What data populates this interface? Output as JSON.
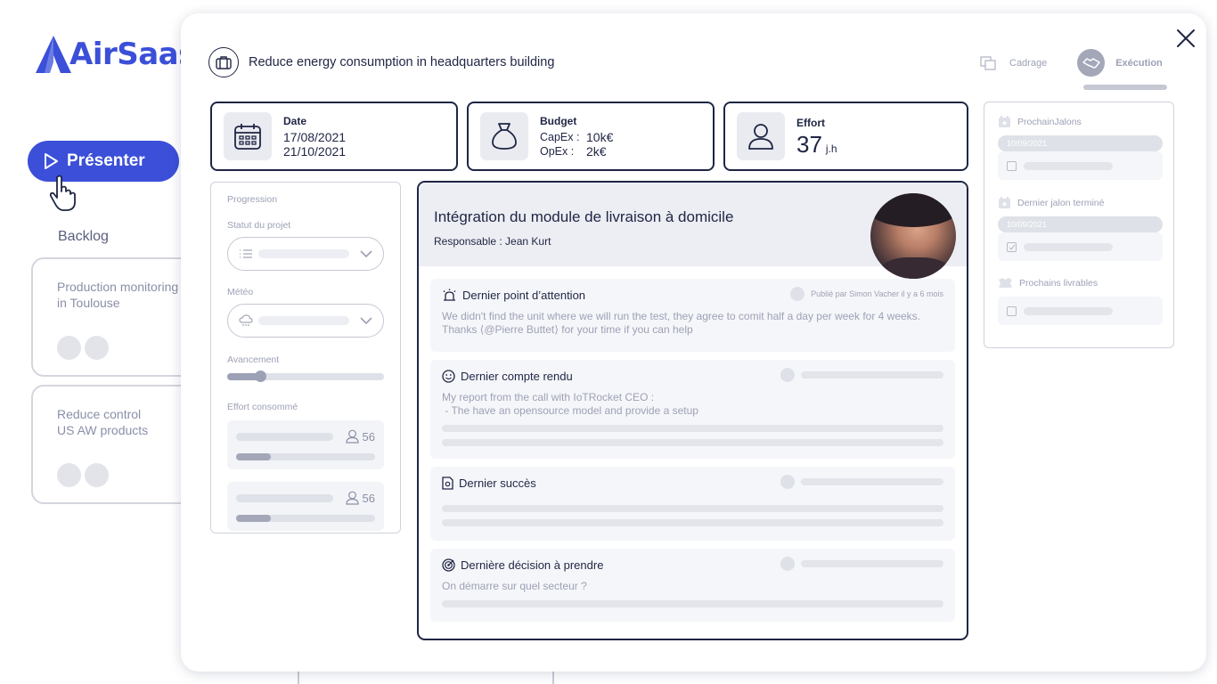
{
  "app": {
    "brand": "AirSaas",
    "brand_color": "#3b4fd8"
  },
  "sidebar": {
    "present_label": "Présenter",
    "backlog_label": "Backlog",
    "cards": [
      {
        "line1": "Production monitoring",
        "line2": "in Toulouse"
      },
      {
        "line1": "Reduce control",
        "line2": "US AW products"
      }
    ]
  },
  "modal": {
    "project_title": "Reduce energy consumption in headquarters building",
    "phases": {
      "cadrage": "Cadrage",
      "execution": "Exécution"
    },
    "date": {
      "label": "Date",
      "start": "17/08/2021",
      "end": "21/10/2021"
    },
    "budget": {
      "label": "Budget",
      "capex_key": "CapEx :",
      "capex_val": "10k€",
      "opex_key": "OpEx :",
      "opex_val": "2k€"
    },
    "effort": {
      "label": "Effort",
      "value": "37",
      "unit": "j.h"
    },
    "left": {
      "progression": "Progression",
      "status": "Statut du projet",
      "meteo": "Météo",
      "advancement": "Avancement",
      "advancement_fraction": 0.21,
      "effort_consumed": "Effort consommé",
      "effort_rows": [
        {
          "value": "56",
          "fraction": 0.25
        },
        {
          "value": "56",
          "fraction": 0.25
        }
      ]
    },
    "main": {
      "title": "Intégration du module de livraison à domicile",
      "responsible": "Responsable : Jean Kurt",
      "attention": {
        "title": "Dernier point d’attention",
        "meta": "Publié par Simon Vacher il y a 6 mois",
        "text1": "We didn't find the unit where we will run the test, they agree to comit half a day per week for 4 weeks.",
        "text2": "Thanks ⟨@Pierre Buttet⟩ for your time if you can help"
      },
      "report": {
        "title": "Dernier compte rendu",
        "text1": "My report from the call with IoTRocket CEO :",
        "text2": " - The have an opensource model and provide a setup"
      },
      "success": {
        "title": "Dernier succès"
      },
      "decision": {
        "title": "Dernière décision à prendre",
        "text": "On démarre sur quel secteur ?"
      }
    },
    "right": {
      "next_milestones": "ProchainJalons",
      "next_date": "10/09/2021",
      "last_milestone": "Dernier jalon terminé",
      "last_date": "10/09/2021",
      "next_deliverables": "Prochains livrables"
    }
  }
}
